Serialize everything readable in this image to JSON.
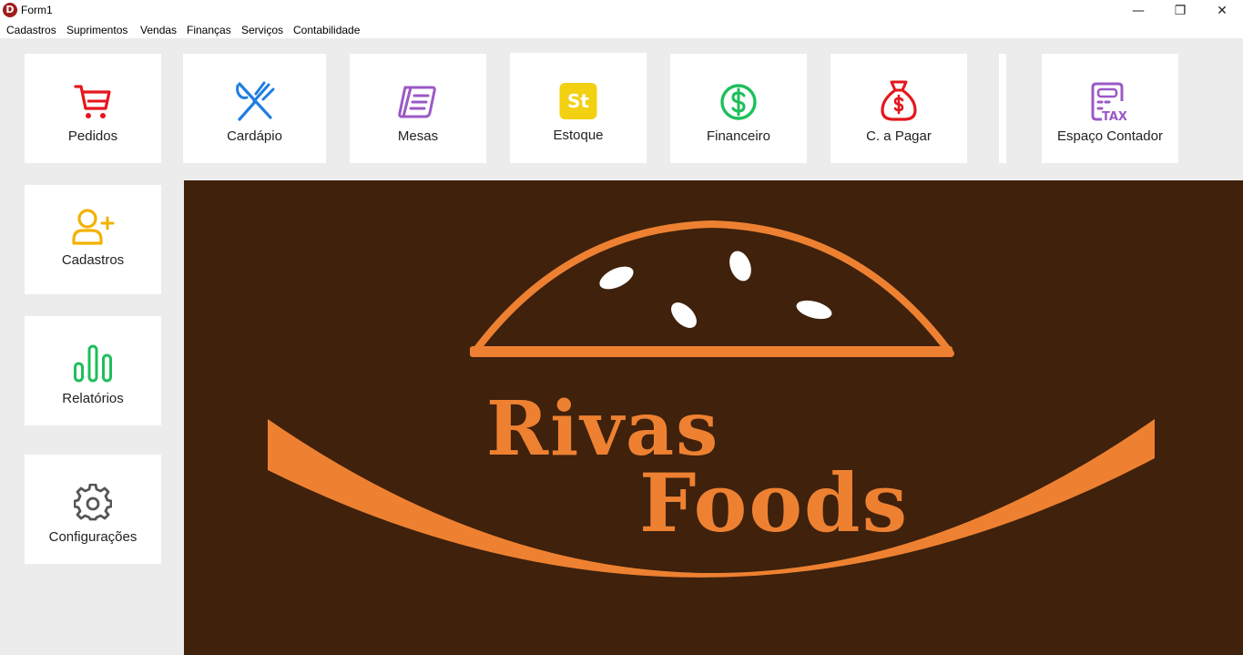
{
  "window": {
    "title": "Form1",
    "app_icon_letter": "D",
    "controls": {
      "minimize": "—",
      "restore": "❐",
      "close": "✕"
    }
  },
  "menu": [
    "Cadastros",
    "Suprimentos",
    "Vendas",
    "Finanças",
    "Serviços",
    "Contabilidade"
  ],
  "top_tiles": [
    {
      "label": "Pedidos",
      "icon": "cart-icon",
      "color": "#e5161d"
    },
    {
      "label": "Cardápio",
      "icon": "fork-knife-icon",
      "color": "#1f7de0"
    },
    {
      "label": "Mesas",
      "icon": "notes-icon",
      "color": "#9b59c6"
    },
    {
      "label": "Estoque",
      "icon": "stock-st-icon",
      "color": "#f2d012",
      "icon_text": "St"
    },
    {
      "label": "Financeiro",
      "icon": "dollar-circle-icon",
      "color": "#1dbf5a"
    },
    {
      "label": "C. a Pagar",
      "icon": "money-bag-icon",
      "color": "#e5161d"
    },
    {
      "label": "Espaço Contador",
      "icon": "tax-icon",
      "color": "#9b59c6",
      "icon_text": "TAX"
    }
  ],
  "side_tiles": [
    {
      "label": "Cadastros",
      "icon": "add-user-icon",
      "color": "#f2b200"
    },
    {
      "label": "Relatórios",
      "icon": "bar-chart-icon",
      "color": "#1dbf5a"
    },
    {
      "label": "Configurações",
      "icon": "gear-icon",
      "color": "#555555"
    }
  ],
  "logo": {
    "line1": "Rivas",
    "line2": "Foods",
    "brand_color": "#ee8131",
    "background": "#3f210c"
  }
}
